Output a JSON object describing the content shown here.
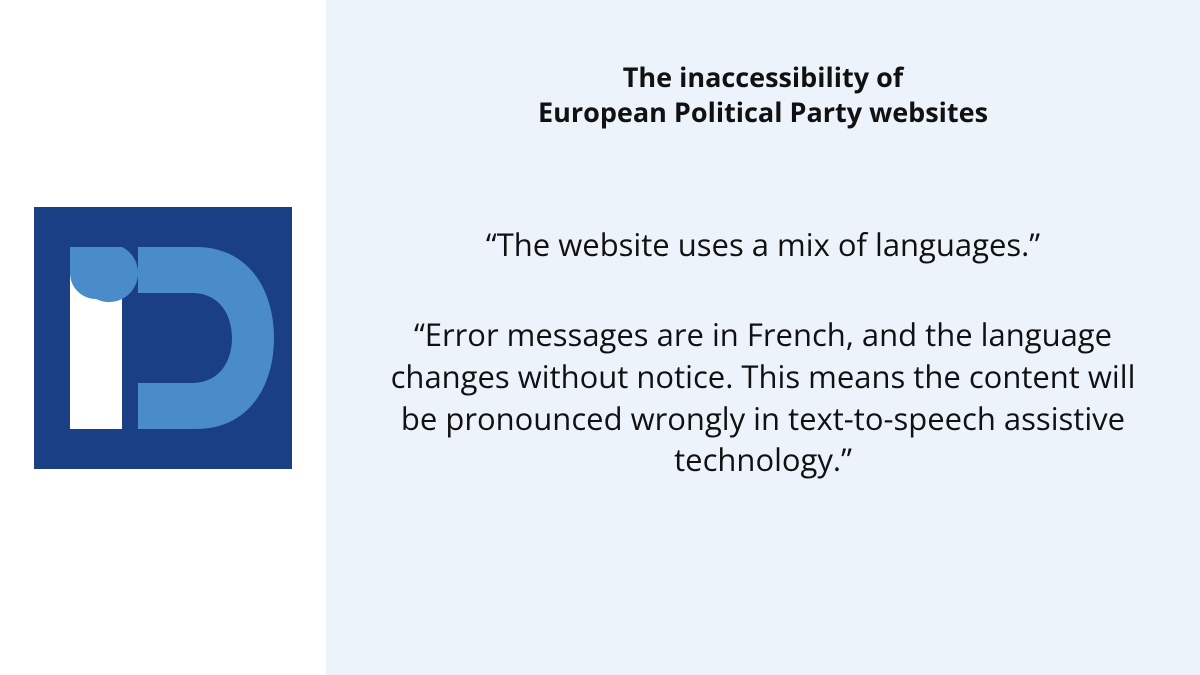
{
  "title_line1": "The inaccessibility of",
  "title_line2": "European Political Party websites",
  "quote1": "“The website uses a mix of languages.”",
  "quote2": "“Error messages are in French, and the language changes without notice. This means the content will be pronounced wrongly in text-to-speech assistive technology.”",
  "colors": {
    "panel_bg": "#edf3fb",
    "logo_bg": "#1a3f85",
    "logo_fg": "#4a8cc9"
  }
}
